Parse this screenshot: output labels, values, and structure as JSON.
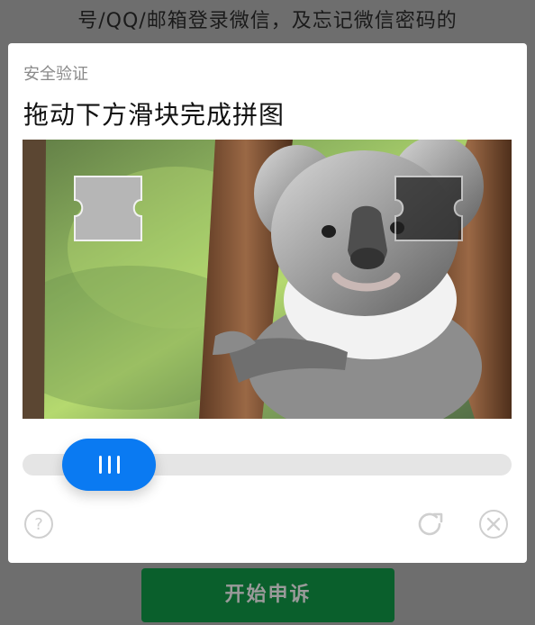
{
  "background": {
    "top_text": "号/QQ/邮箱登录微信，及忘记微信密码的",
    "button_label": "开始申诉"
  },
  "captcha": {
    "subtitle": "安全验证",
    "title": "拖动下方滑块完成拼图",
    "slider": {
      "handle_icon": "grip-lines-icon",
      "position_fraction": 0.11
    },
    "icons": {
      "help": "help-circle-icon",
      "refresh": "refresh-icon",
      "close": "close-circle-icon"
    }
  },
  "colors": {
    "overlay_bg": "#6e6e6e",
    "slider_handle": "#0a7af2",
    "slider_track": "#e5e5e5",
    "background_button": "#0a5f2c"
  }
}
